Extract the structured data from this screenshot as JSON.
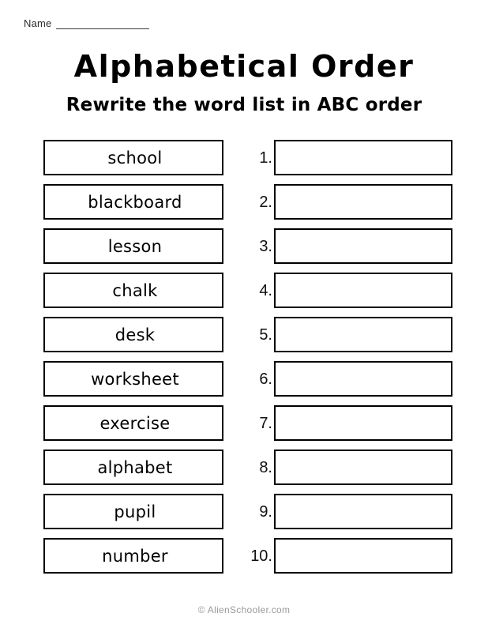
{
  "worksheet": {
    "name_label": "Name",
    "title": "Alphabetical Order",
    "subtitle": "Rewrite the word list in ABC order",
    "footer": "© AlienSchooler.com",
    "rows": [
      {
        "number": "1.",
        "word": "school"
      },
      {
        "number": "2.",
        "word": "blackboard"
      },
      {
        "number": "3.",
        "word": "lesson"
      },
      {
        "number": "4.",
        "word": "chalk"
      },
      {
        "number": "5.",
        "word": "desk"
      },
      {
        "number": "6.",
        "word": "worksheet"
      },
      {
        "number": "7.",
        "word": "exercise"
      },
      {
        "number": "8.",
        "word": "alphabet"
      },
      {
        "number": "9.",
        "word": "pupil"
      },
      {
        "number": "10.",
        "word": "number"
      }
    ],
    "answers": [
      "",
      "",
      "",
      "",
      "",
      "",
      "",
      "",
      "",
      ""
    ]
  }
}
